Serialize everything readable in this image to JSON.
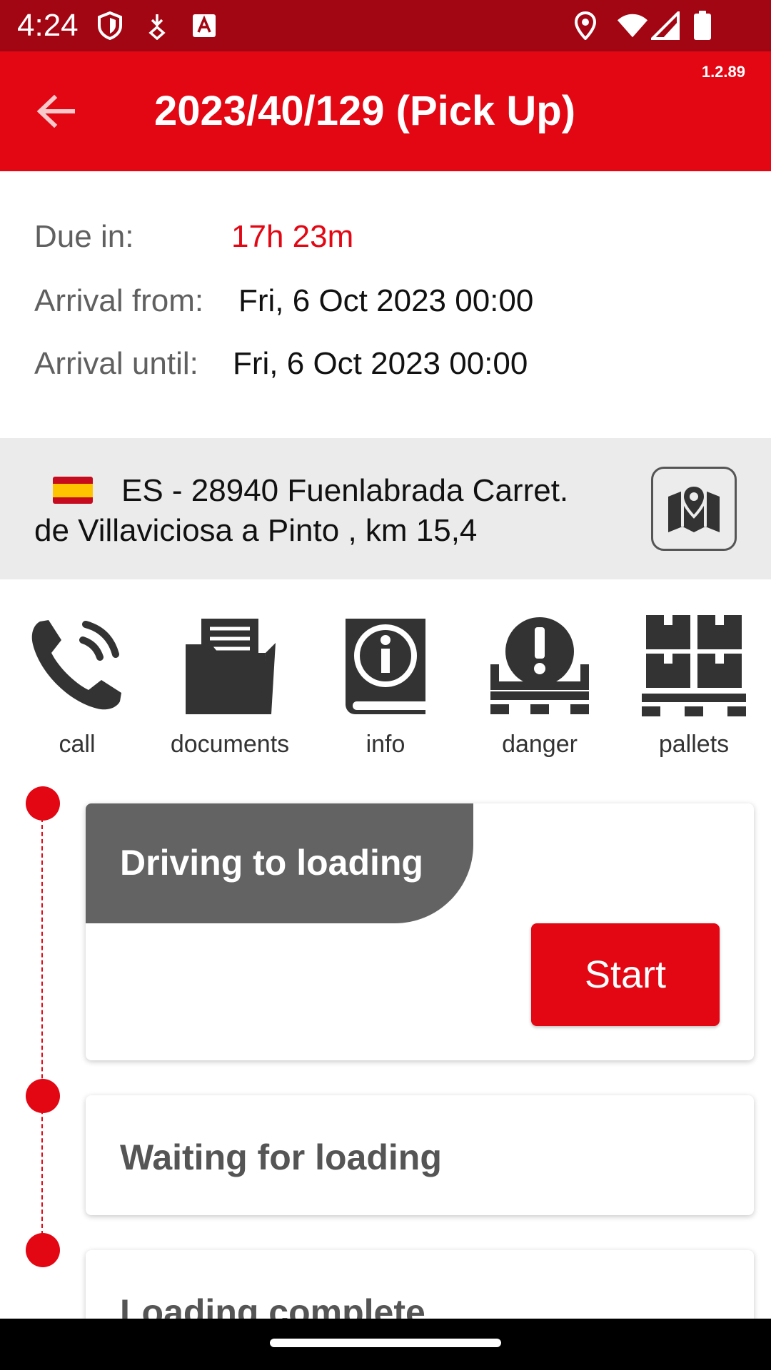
{
  "status_bar": {
    "time": "4:24",
    "left_icons": [
      "shield-icon",
      "download-icon",
      "font-icon"
    ],
    "right_icons": [
      "location-icon",
      "wifi-icon",
      "signal-icon",
      "battery-icon"
    ]
  },
  "app_bar": {
    "title": "2023/40/129 (Pick Up)",
    "version": "1.2.89",
    "back_icon": "arrow-left-icon"
  },
  "details": {
    "due_label": "Due in:",
    "due_value": "17h 23m",
    "arrival_from_label": "Arrival from:",
    "arrival_from_value": "Fri, 6 Oct 2023 00:00",
    "arrival_until_label": "Arrival until:",
    "arrival_until_value": "Fri, 6 Oct 2023 00:00"
  },
  "address": {
    "flag": "spain-flag",
    "line1": "ES - 28940 Fuenlabrada Carret.",
    "line2": "de Villaviciosa a Pinto , km 15,4",
    "map_icon": "map-pin-icon"
  },
  "actions": [
    {
      "label": "call",
      "icon": "phone-icon"
    },
    {
      "label": "documents",
      "icon": "folder-icon"
    },
    {
      "label": "info",
      "icon": "info-book-icon"
    },
    {
      "label": "danger",
      "icon": "danger-pallet-icon"
    },
    {
      "label": "pallets",
      "icon": "pallets-icon"
    }
  ],
  "steps": [
    {
      "title": "Driving to loading",
      "button": "Start"
    },
    {
      "title": "Waiting for loading"
    },
    {
      "title": "Loading complete"
    }
  ],
  "colors": {
    "primary": "#e30613",
    "status_bar": "#a30613",
    "tab_gray": "#636363"
  }
}
